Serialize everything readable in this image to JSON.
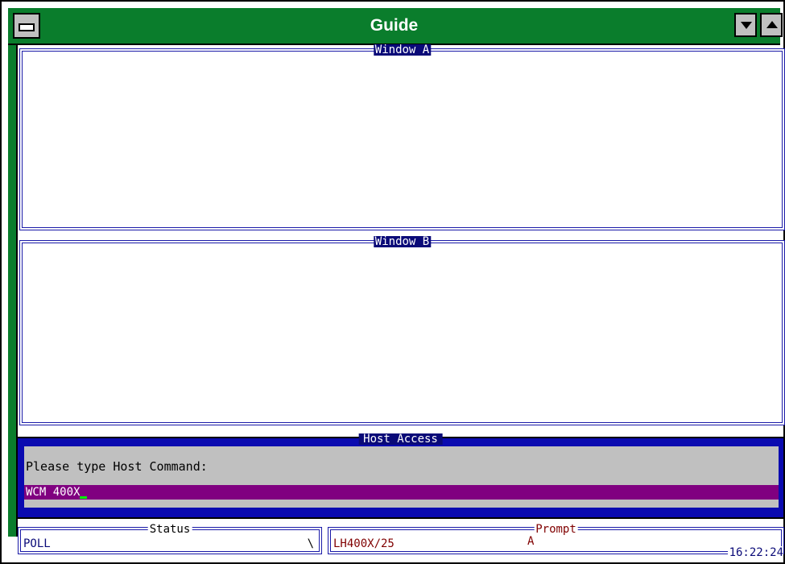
{
  "window": {
    "title": "Guide",
    "colors": {
      "titlebar": "#0a7d2c",
      "panel_border": "#1a1aa8",
      "host_bg": "#0a0ab0",
      "input_bg": "#800080"
    }
  },
  "panels": {
    "window_a": {
      "title": "Window A"
    },
    "window_b": {
      "title": "Window B"
    }
  },
  "host_access": {
    "title": "Host Access",
    "prompt": "Please type Host Command:",
    "command_value": "WCM 400X"
  },
  "status": {
    "title": "Status",
    "value": "POLL",
    "spinner": "\\"
  },
  "prompt": {
    "title": "Prompt",
    "value": "LH400X/25",
    "letter": "A"
  },
  "clock": "16:22:24",
  "icons": {
    "system_menu": "system-menu-icon",
    "minimize": "chevron-down-icon",
    "maximize": "chevron-up-icon"
  }
}
